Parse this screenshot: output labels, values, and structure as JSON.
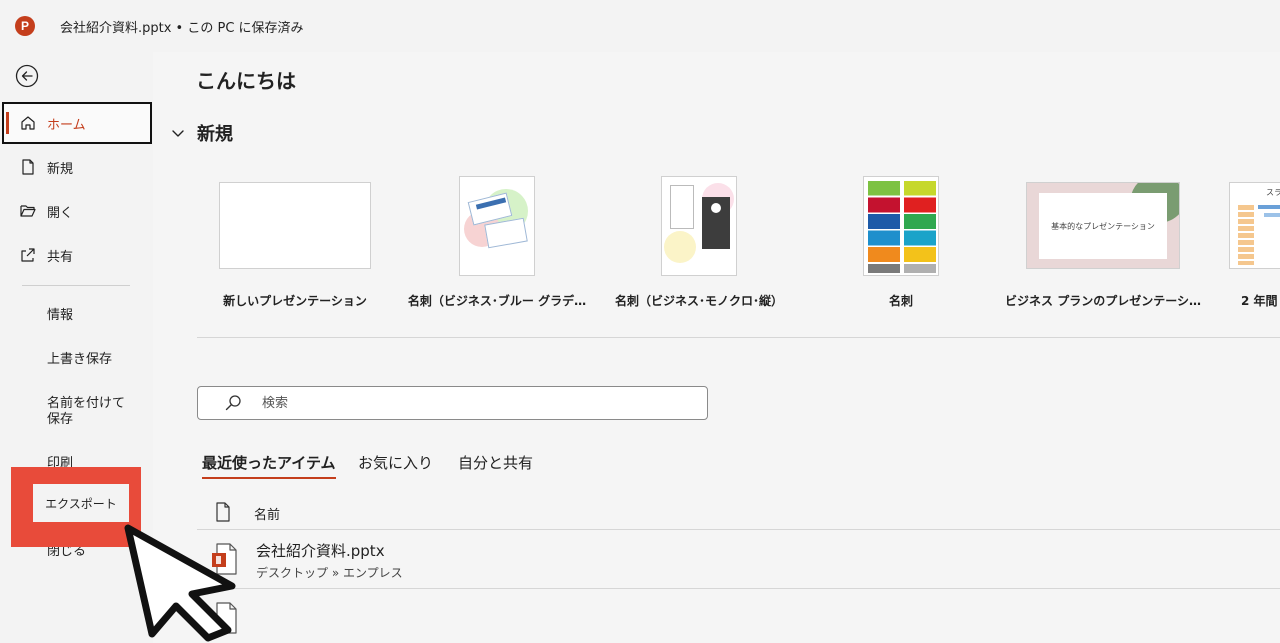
{
  "titlebar": {
    "app_logo": "P",
    "title": "会社紹介資料.pptx • この PC に保存済み"
  },
  "sidebar": {
    "back_icon": "back-arrow-icon",
    "items": [
      {
        "label": "ホーム",
        "icon": "home-icon"
      },
      {
        "label": "新規",
        "icon": "new-document-icon"
      },
      {
        "label": "開く",
        "icon": "folder-open-icon"
      },
      {
        "label": "共有",
        "icon": "share-icon"
      }
    ],
    "lower_items": [
      "情報",
      "上書き保存",
      "名前を付けて保存",
      "印刷",
      "エクスポート",
      "閉じる"
    ]
  },
  "main": {
    "greeting": "こんにちは",
    "new_section": "新規",
    "templates": [
      {
        "label": "新しいプレゼンテーション"
      },
      {
        "label": "名刺（ビジネス･ブルー グラデ…"
      },
      {
        "label": "名刺（ビジネス･モノクロ･縦）"
      },
      {
        "label": "名刺"
      },
      {
        "label": "ビジネス プランのプレゼンテーシ…",
        "thumb_text": "基本的なプレゼンテーション"
      },
      {
        "label": "2 年間",
        "thumb_text": "スライ"
      }
    ],
    "search": {
      "placeholder": "検索"
    },
    "tabs": [
      "最近使ったアイテム",
      "お気に入り",
      "自分と共有"
    ],
    "list_header": "名前",
    "files": [
      {
        "name": "会社紹介資料.pptx",
        "path": "デスクトップ » エンプレス"
      },
      {
        "name": "",
        "path": ""
      }
    ]
  },
  "colors": {
    "accent": "#c43e1c",
    "highlight": "#e84b3a",
    "background": "#f5f5f5"
  }
}
